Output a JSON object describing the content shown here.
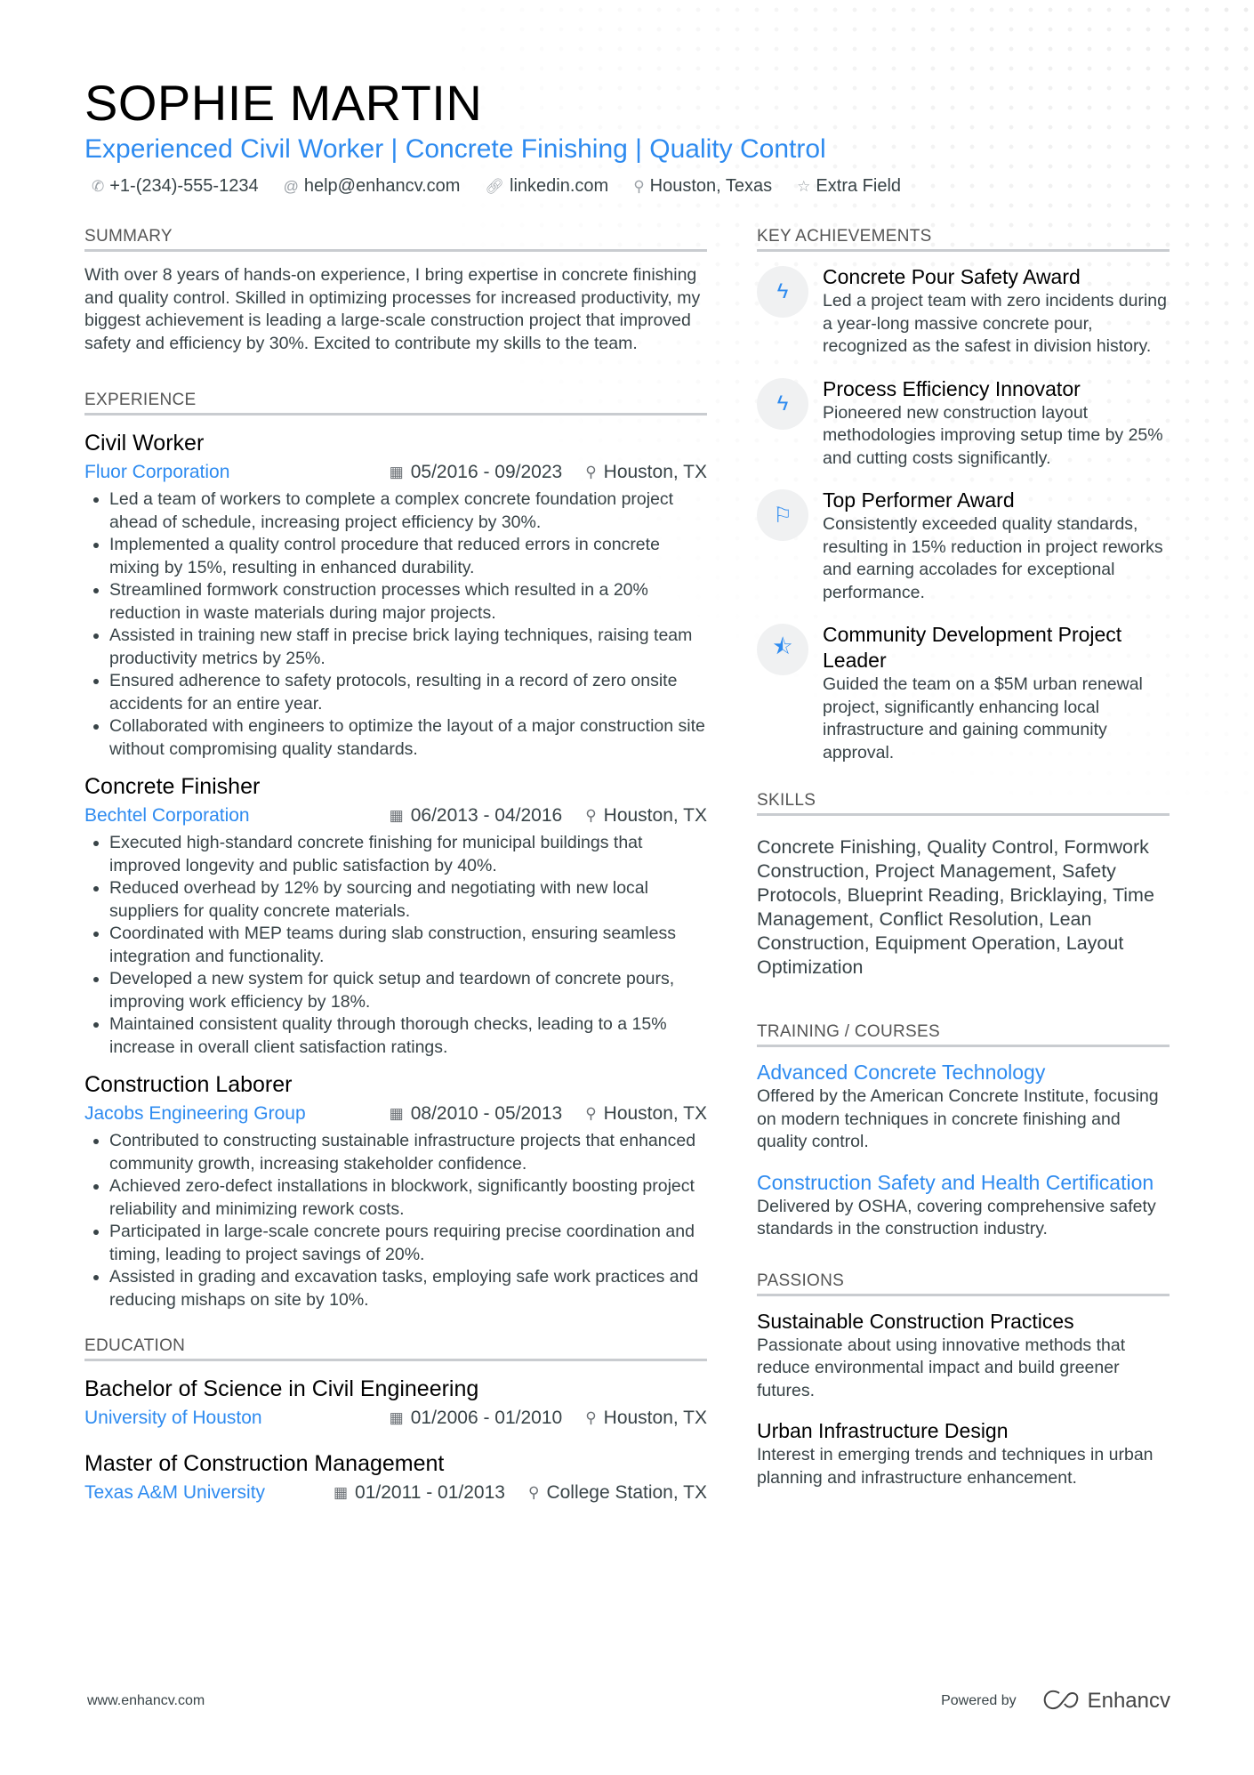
{
  "header": {
    "name": "SOPHIE MARTIN",
    "headline": "Experienced Civil Worker | Concrete Finishing | Quality Control",
    "contacts": [
      {
        "icon": "phone-icon",
        "glyph": "✆",
        "text": "+1-(234)-555-1234"
      },
      {
        "icon": "at-icon",
        "glyph": "@",
        "text": "help@enhancv.com"
      },
      {
        "icon": "link-icon",
        "glyph": "🔗︎",
        "text": "linkedin.com"
      },
      {
        "icon": "location-pin-icon",
        "glyph": "⚲",
        "text": "Houston, Texas"
      },
      {
        "icon": "star-icon",
        "glyph": "☆",
        "text": "Extra Field"
      }
    ]
  },
  "summary": {
    "title": "SUMMARY",
    "text": "With over 8 years of hands-on experience, I bring expertise in concrete finishing and quality control. Skilled in optimizing processes for increased productivity, my biggest achievement is leading a large-scale construction project that improved safety and efficiency by 30%. Excited to contribute my skills to the team."
  },
  "experience": {
    "title": "EXPERIENCE",
    "jobs": [
      {
        "title": "Civil Worker",
        "company": "Fluor Corporation",
        "dates": "05/2016 - 09/2023",
        "location": "Houston, TX",
        "bullets": [
          "Led a team of workers to complete a complex concrete foundation project ahead of schedule, increasing project efficiency by 30%.",
          "Implemented a quality control procedure that reduced errors in concrete mixing by 15%, resulting in enhanced durability.",
          "Streamlined formwork construction processes which resulted in a 20% reduction in waste materials during major projects.",
          "Assisted in training new staff in precise brick laying techniques, raising team productivity metrics by 25%.",
          "Ensured adherence to safety protocols, resulting in a record of zero onsite accidents for an entire year.",
          "Collaborated with engineers to optimize the layout of a major construction site without compromising quality standards."
        ]
      },
      {
        "title": "Concrete Finisher",
        "company": "Bechtel Corporation",
        "dates": "06/2013 - 04/2016",
        "location": "Houston, TX",
        "bullets": [
          "Executed high-standard concrete finishing for municipal buildings that improved longevity and public satisfaction by 40%.",
          "Reduced overhead by 12% by sourcing and negotiating with new local suppliers for quality concrete materials.",
          "Coordinated with MEP teams during slab construction, ensuring seamless integration and functionality.",
          "Developed a new system for quick setup and teardown of concrete pours, improving work efficiency by 18%.",
          "Maintained consistent quality through thorough checks, leading to a 15% increase in overall client satisfaction ratings."
        ]
      },
      {
        "title": "Construction Laborer",
        "company": "Jacobs Engineering Group",
        "dates": "08/2010 - 05/2013",
        "location": "Houston, TX",
        "bullets": [
          "Contributed to constructing sustainable infrastructure projects that enhanced community growth, increasing stakeholder confidence.",
          "Achieved zero-defect installations in blockwork, significantly boosting project reliability and minimizing rework costs.",
          "Participated in large-scale concrete pours requiring precise coordination and timing, leading to project savings of 20%.",
          "Assisted in grading and excavation tasks, employing safe work practices and reducing mishaps on site by 10%."
        ]
      }
    ]
  },
  "education": {
    "title": "EDUCATION",
    "items": [
      {
        "degree": "Bachelor of Science in Civil Engineering",
        "school": "University of Houston",
        "dates": "01/2006 - 01/2010",
        "location": "Houston, TX"
      },
      {
        "degree": "Master of Construction Management",
        "school": "Texas A&M University",
        "dates": "01/2011 - 01/2013",
        "location": "College Station, TX"
      }
    ]
  },
  "achievements": {
    "title": "KEY ACHIEVEMENTS",
    "items": [
      {
        "icon": "lightning-icon",
        "glyph": "ϟ",
        "title": "Concrete Pour Safety Award",
        "desc": "Led a project team with zero incidents during a year-long massive concrete pour, recognized as the safest in division history."
      },
      {
        "icon": "lightning-icon",
        "glyph": "ϟ",
        "title": "Process Efficiency Innovator",
        "desc": "Pioneered new construction layout methodologies improving setup time by 25% and cutting costs significantly."
      },
      {
        "icon": "flag-icon",
        "glyph": "⚐",
        "title": "Top Performer Award",
        "desc": "Consistently exceeded quality standards, resulting in 15% reduction in project reworks and earning accolades for exceptional performance."
      },
      {
        "icon": "half-star-icon",
        "glyph": "⯪",
        "title": "Community Development Project Leader",
        "desc": "Guided the team on a $5M urban renewal project, significantly enhancing local infrastructure and gaining community approval."
      }
    ]
  },
  "skills": {
    "title": "SKILLS",
    "text": "Concrete Finishing, Quality Control, Formwork Construction, Project Management, Safety Protocols, Blueprint Reading, Bricklaying, Time Management, Conflict Resolution, Lean Construction, Equipment Operation, Layout Optimization"
  },
  "training": {
    "title": "TRAINING / COURSES",
    "items": [
      {
        "title": "Advanced Concrete Technology",
        "desc": "Offered by the American Concrete Institute, focusing on modern techniques in concrete finishing and quality control."
      },
      {
        "title": "Construction Safety and Health Certification",
        "desc": "Delivered by OSHA, covering comprehensive safety standards in the construction industry."
      }
    ]
  },
  "passions": {
    "title": "PASSIONS",
    "items": [
      {
        "title": "Sustainable Construction Practices",
        "desc": "Passionate about using innovative methods that reduce environmental impact and build greener futures."
      },
      {
        "title": "Urban Infrastructure Design",
        "desc": "Interest in emerging trends and techniques in urban planning and infrastructure enhancement."
      }
    ]
  },
  "footer": {
    "url": "www.enhancv.com",
    "powered_by": "Powered by",
    "brand": "Enhancv"
  },
  "icons": {
    "calendar": "calendar-icon",
    "calendar_glyph": "▦",
    "pin": "location-pin-icon",
    "pin_glyph": "⚲"
  },
  "colors": {
    "accent": "#2e8bf0",
    "text": "#384347",
    "heading": "#000000",
    "rule": "#c9ccd0"
  }
}
